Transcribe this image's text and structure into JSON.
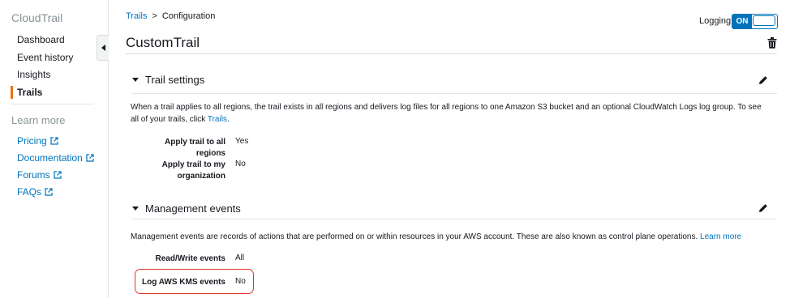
{
  "sidebar": {
    "title": "CloudTrail",
    "items": [
      {
        "label": "Dashboard"
      },
      {
        "label": "Event history"
      },
      {
        "label": "Insights"
      },
      {
        "label": "Trails",
        "active": true
      }
    ],
    "learn_more_title": "Learn more",
    "links": [
      {
        "label": "Pricing",
        "icon": "external-link-icon"
      },
      {
        "label": "Documentation",
        "icon": "external-link-icon"
      },
      {
        "label": "Forums",
        "icon": "external-link-icon"
      },
      {
        "label": "FAQs",
        "icon": "external-link-icon"
      }
    ]
  },
  "breadcrumb": {
    "root": "Trails",
    "separator": ">",
    "current": "Configuration"
  },
  "logging": {
    "label": "Logging",
    "state": "ON"
  },
  "page": {
    "title": "CustomTrail"
  },
  "trail_settings": {
    "title": "Trail settings",
    "description": "When a trail applies to all regions, the trail exists in all regions and delivers log files for all regions to one Amazon S3 bucket and an optional CloudWatch Logs log group. To see all of your trails, click",
    "description_link": "Trails",
    "description_end": ".",
    "fields": [
      {
        "label": "Apply trail to all regions",
        "value": "Yes"
      },
      {
        "label": "Apply trail to my organization",
        "value": "No"
      }
    ]
  },
  "management_events": {
    "title": "Management events",
    "description": "Management events are records of actions that are performed on or within resources in your AWS account. These are also known as control plane operations.",
    "description_link": "Learn more",
    "fields": [
      {
        "label": "Read/Write events",
        "value": "All"
      },
      {
        "label": "Log AWS KMS events",
        "value": "No"
      }
    ]
  },
  "colors": {
    "accent": "#0073bb",
    "active_indicator": "#ec7211",
    "highlight_border": "#e0342a"
  }
}
